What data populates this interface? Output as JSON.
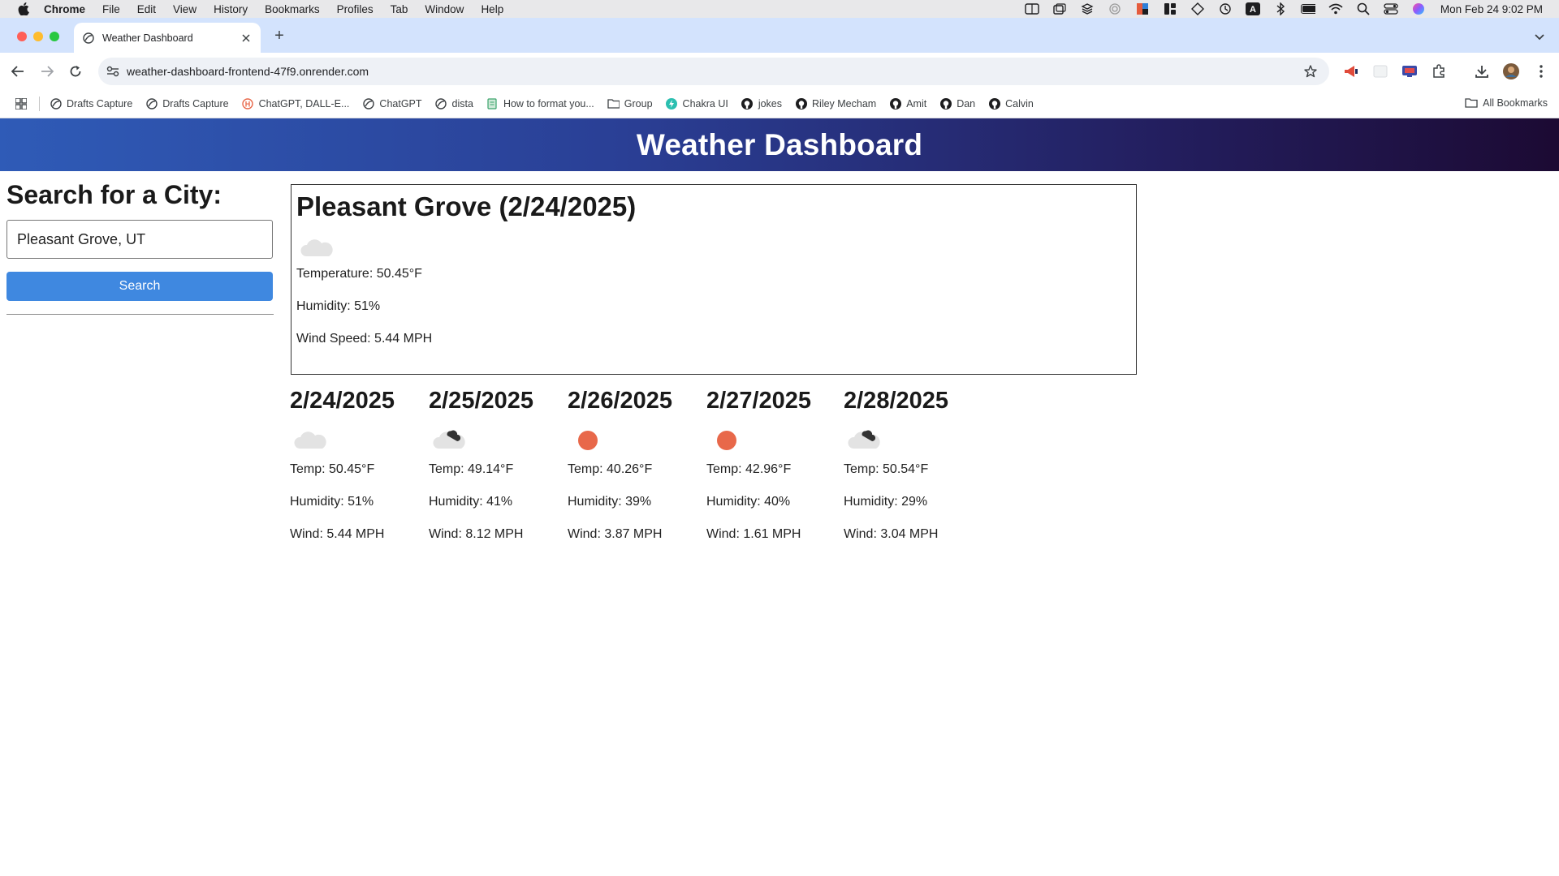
{
  "mac_menubar": {
    "app_name": "Chrome",
    "menus": [
      "File",
      "Edit",
      "View",
      "History",
      "Bookmarks",
      "Profiles",
      "Tab",
      "Window",
      "Help"
    ],
    "clock": "Mon Feb 24  9:02 PM"
  },
  "browser": {
    "tab_title": "Weather Dashboard",
    "new_tab_label": "+",
    "url": "weather-dashboard-frontend-47f9.onrender.com",
    "bookmarks": [
      {
        "label": "Drafts Capture",
        "icon": "globe-icon"
      },
      {
        "label": "Drafts Capture",
        "icon": "globe-icon"
      },
      {
        "label": "ChatGPT, DALL-E...",
        "icon": "h-logo-icon"
      },
      {
        "label": "ChatGPT",
        "icon": "globe-icon"
      },
      {
        "label": "dista",
        "icon": "globe-icon"
      },
      {
        "label": "How to format you...",
        "icon": "doc-icon"
      },
      {
        "label": "Group",
        "icon": "folder-icon"
      },
      {
        "label": "Chakra UI",
        "icon": "chakra-icon"
      },
      {
        "label": "jokes",
        "icon": "github-icon"
      },
      {
        "label": "Riley Mecham",
        "icon": "github-icon"
      },
      {
        "label": "Amit",
        "icon": "github-icon"
      },
      {
        "label": "Dan",
        "icon": "github-icon"
      },
      {
        "label": "Calvin",
        "icon": "github-icon"
      }
    ],
    "all_bookmarks_label": "All Bookmarks"
  },
  "app": {
    "title": "Weather Dashboard",
    "search_heading": "Search for a City:",
    "search_value": "Pleasant Grove, UT",
    "search_button": "Search",
    "colors": {
      "accent": "#3f88e0",
      "sun": "#e8684a",
      "cloud": "#e3e3e3"
    }
  },
  "today": {
    "heading": "Pleasant Grove (2/24/2025)",
    "icon": "cloud-icon",
    "temperature": "Temperature: 50.45°F",
    "humidity": "Humidity: 51%",
    "wind": "Wind Speed: 5.44 MPH"
  },
  "forecast": [
    {
      "date": "2/24/2025",
      "icon": "cloud-icon",
      "temp": "Temp: 50.45°F",
      "humidity": "Humidity: 51%",
      "wind": "Wind: 5.44 MPH"
    },
    {
      "date": "2/25/2025",
      "icon": "broken-clouds-icon",
      "temp": "Temp: 49.14°F",
      "humidity": "Humidity: 41%",
      "wind": "Wind: 8.12 MPH"
    },
    {
      "date": "2/26/2025",
      "icon": "sun-icon",
      "temp": "Temp: 40.26°F",
      "humidity": "Humidity: 39%",
      "wind": "Wind: 3.87 MPH"
    },
    {
      "date": "2/27/2025",
      "icon": "sun-icon",
      "temp": "Temp: 42.96°F",
      "humidity": "Humidity: 40%",
      "wind": "Wind: 1.61 MPH"
    },
    {
      "date": "2/28/2025",
      "icon": "broken-clouds-icon",
      "temp": "Temp: 50.54°F",
      "humidity": "Humidity: 29%",
      "wind": "Wind: 3.04 MPH"
    }
  ]
}
